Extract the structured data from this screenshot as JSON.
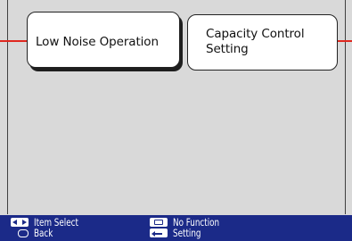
{
  "tiles": [
    {
      "label": "Low Noise Operation",
      "selected": true
    },
    {
      "label": "Capacity Control\nSetting",
      "selected": false
    }
  ],
  "hints": {
    "item_select": {
      "icon": "left-right-arrows-icon",
      "label": "Item Select"
    },
    "back": {
      "icon": "back-button-icon",
      "label": "Back"
    },
    "no_function": {
      "icon": "menu-button-icon",
      "label": "No Function"
    },
    "setting": {
      "icon": "enter-button-icon",
      "label": "Setting"
    }
  },
  "colors": {
    "background": "#d9d9d9",
    "connector": "#e0281f",
    "footer": "#1b2a88",
    "tile": "#ffffff"
  }
}
